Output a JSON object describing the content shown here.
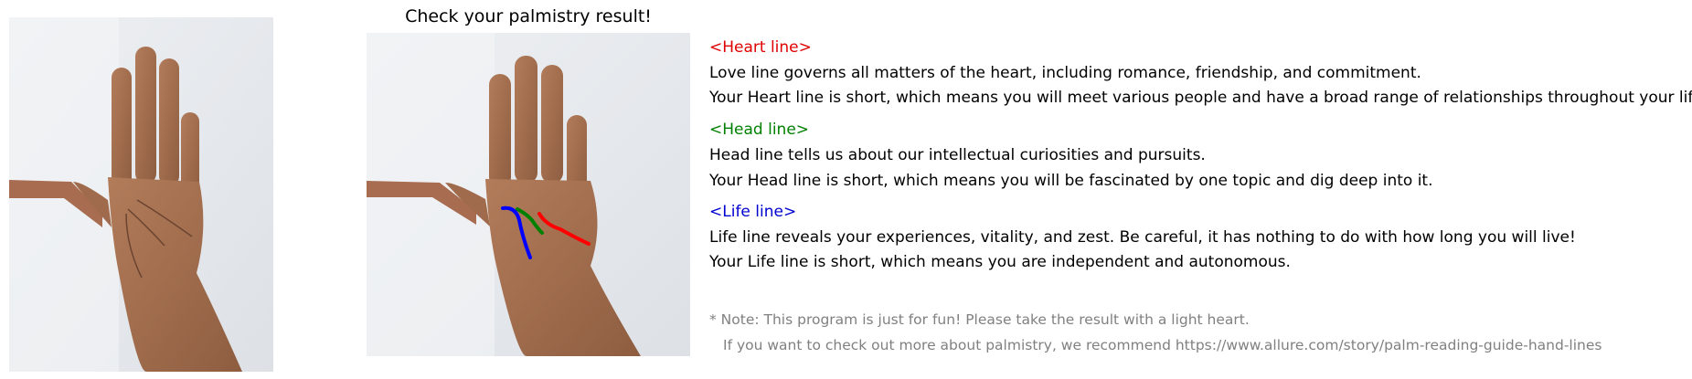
{
  "title": "Check your palmistry result!",
  "sections": [
    {
      "heading": "<Heart line>",
      "color": "#e00000",
      "description": "Love line governs all matters of the heart, including romance, friendship, and commitment.",
      "result": "Your Heart line is short, which means you will meet various people and have a broad range of relationships throughout your life."
    },
    {
      "heading": "<Head line>",
      "color": "#008000",
      "description": "Head line tells us about our intellectual curiosities and pursuits.",
      "result": "Your Head line is short, which means you will be fascinated by one topic and dig deep into it."
    },
    {
      "heading": "<Life line>",
      "color": "#0000d0",
      "description": "Life line reveals your experiences, vitality, and zest. Be careful, it has nothing to do with how long you will live!",
      "result": "Your Life line is short, which means you are independent and autonomous."
    }
  ],
  "note": {
    "line1": "* Note: This program is just for fun! Please take the result with a light heart.",
    "line2": "If you want to check out more about palmistry, we recommend https://www.allure.com/story/palm-reading-guide-hand-lines"
  },
  "line_colors": {
    "heart": "#ff0000",
    "head": "#008000",
    "life": "#0000ff"
  }
}
